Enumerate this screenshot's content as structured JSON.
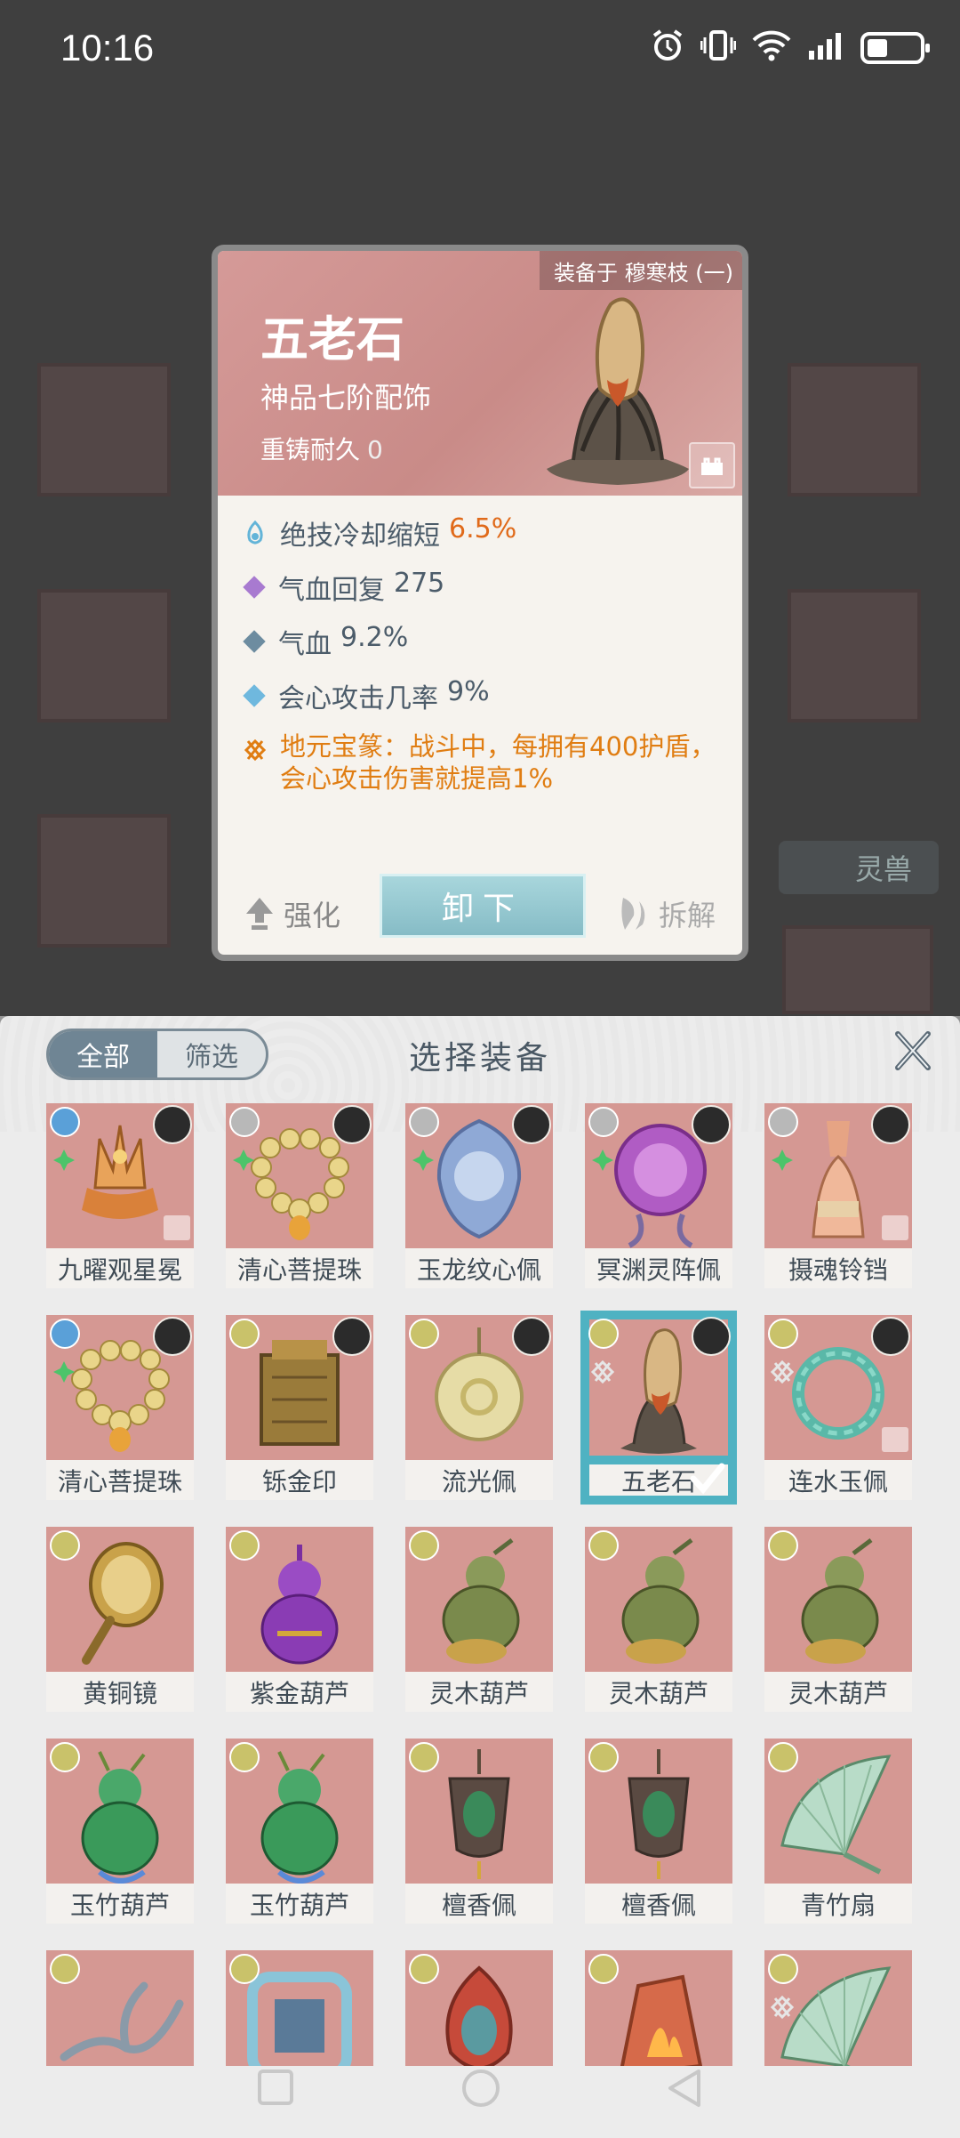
{
  "status_bar": {
    "time": "10:16"
  },
  "background": {
    "side_pill": "灵兽"
  },
  "detail": {
    "equipped_label": "装备于 穆寒枝 (一)",
    "name": "五老石",
    "grade": "神品七阶配饰",
    "durability_label": "重铸耐久",
    "durability_value": "0",
    "stats": [
      {
        "label": "绝技冷却缩短",
        "value": "6.5%",
        "icon": "cooldown-icon",
        "color": "#63b4d8"
      },
      {
        "label": "气血回复",
        "value": "275",
        "icon": "diamond-icon",
        "color": "#a87ad0"
      },
      {
        "label": "气血",
        "value": "9.2%",
        "icon": "diamond-icon",
        "color": "#6d8ca0"
      },
      {
        "label": "会心攻击几率",
        "value": "9%",
        "icon": "diamond-icon",
        "color": "#6fb8de"
      }
    ],
    "special_text": "地元宝篆：战斗中，每拥有400护盾，会心攻击伤害就提高1%",
    "upgrade_label": "强化",
    "unequip_label": "卸下",
    "dismantle_label": "拆解"
  },
  "panel": {
    "tab_all": "全部",
    "tab_filter": "筛选",
    "title": "选择装备",
    "items": [
      {
        "name": "九曜观星冕",
        "elem": "#5aa0d8",
        "avatar": true,
        "lock": true,
        "fleur": "green",
        "art": "crown"
      },
      {
        "name": "清心菩提珠",
        "elem": "#b8b8b8",
        "avatar": true,
        "lock": false,
        "fleur": "green",
        "art": "beads"
      },
      {
        "name": "玉龙纹心佩",
        "elem": "#b8b8b8",
        "avatar": true,
        "lock": false,
        "fleur": "green",
        "art": "jade"
      },
      {
        "name": "冥渊灵阵佩",
        "elem": "#b8b8b8",
        "avatar": true,
        "lock": false,
        "fleur": "green",
        "art": "orb"
      },
      {
        "name": "摄魂铃铛",
        "elem": "#b8b8b8",
        "avatar": true,
        "lock": true,
        "fleur": "green",
        "art": "bell"
      },
      {
        "name": "清心菩提珠",
        "elem": "#5aa0d8",
        "avatar": true,
        "lock": false,
        "fleur": "green",
        "art": "beads"
      },
      {
        "name": "铄金印",
        "elem": "#c9c26a",
        "avatar": true,
        "lock": false,
        "fleur": "",
        "art": "seal"
      },
      {
        "name": "流光佩",
        "elem": "#c9c26a",
        "avatar": true,
        "lock": false,
        "fleur": "",
        "art": "ring"
      },
      {
        "name": "五老石",
        "elem": "#c9c26a",
        "avatar": true,
        "lock": false,
        "fleur": "red",
        "art": "stone",
        "selected": true
      },
      {
        "name": "连水玉佩",
        "elem": "#c9c26a",
        "avatar": true,
        "lock": true,
        "fleur": "red",
        "art": "wreath"
      },
      {
        "name": "黄铜镜",
        "elem": "#c9c26a",
        "avatar": false,
        "lock": false,
        "fleur": "",
        "art": "mirror"
      },
      {
        "name": "紫金葫芦",
        "elem": "#c9c26a",
        "avatar": false,
        "lock": false,
        "fleur": "",
        "art": "gourd-purple"
      },
      {
        "name": "灵木葫芦",
        "elem": "#c9c26a",
        "avatar": false,
        "lock": false,
        "fleur": "",
        "art": "gourd-olive"
      },
      {
        "name": "灵木葫芦",
        "elem": "#c9c26a",
        "avatar": false,
        "lock": false,
        "fleur": "",
        "art": "gourd-olive"
      },
      {
        "name": "灵木葫芦",
        "elem": "#c9c26a",
        "avatar": false,
        "lock": false,
        "fleur": "",
        "art": "gourd-olive"
      },
      {
        "name": "玉竹葫芦",
        "elem": "#c9c26a",
        "avatar": false,
        "lock": false,
        "fleur": "",
        "art": "gourd-green"
      },
      {
        "name": "玉竹葫芦",
        "elem": "#c9c26a",
        "avatar": false,
        "lock": false,
        "fleur": "",
        "art": "gourd-green"
      },
      {
        "name": "檀香佩",
        "elem": "#c9c26a",
        "avatar": false,
        "lock": false,
        "fleur": "",
        "art": "pendant"
      },
      {
        "name": "檀香佩",
        "elem": "#c9c26a",
        "avatar": false,
        "lock": false,
        "fleur": "",
        "art": "pendant"
      },
      {
        "name": "青竹扇",
        "elem": "#c9c26a",
        "avatar": false,
        "lock": false,
        "fleur": "",
        "art": "fan"
      },
      {
        "name": "",
        "elem": "#c9c26a",
        "avatar": false,
        "lock": false,
        "fleur": "",
        "art": "branch",
        "partial": true
      },
      {
        "name": "",
        "elem": "#c9c26a",
        "avatar": false,
        "lock": false,
        "fleur": "",
        "art": "frame",
        "partial": true
      },
      {
        "name": "",
        "elem": "#c9c26a",
        "avatar": false,
        "lock": false,
        "fleur": "",
        "art": "flame-gem",
        "partial": true
      },
      {
        "name": "",
        "elem": "#c9c26a",
        "avatar": false,
        "lock": false,
        "fleur": "",
        "art": "fire-stone",
        "partial": true
      },
      {
        "name": "",
        "elem": "#c9c26a",
        "avatar": false,
        "lock": false,
        "fleur": "red",
        "art": "fan",
        "partial": true
      }
    ]
  }
}
